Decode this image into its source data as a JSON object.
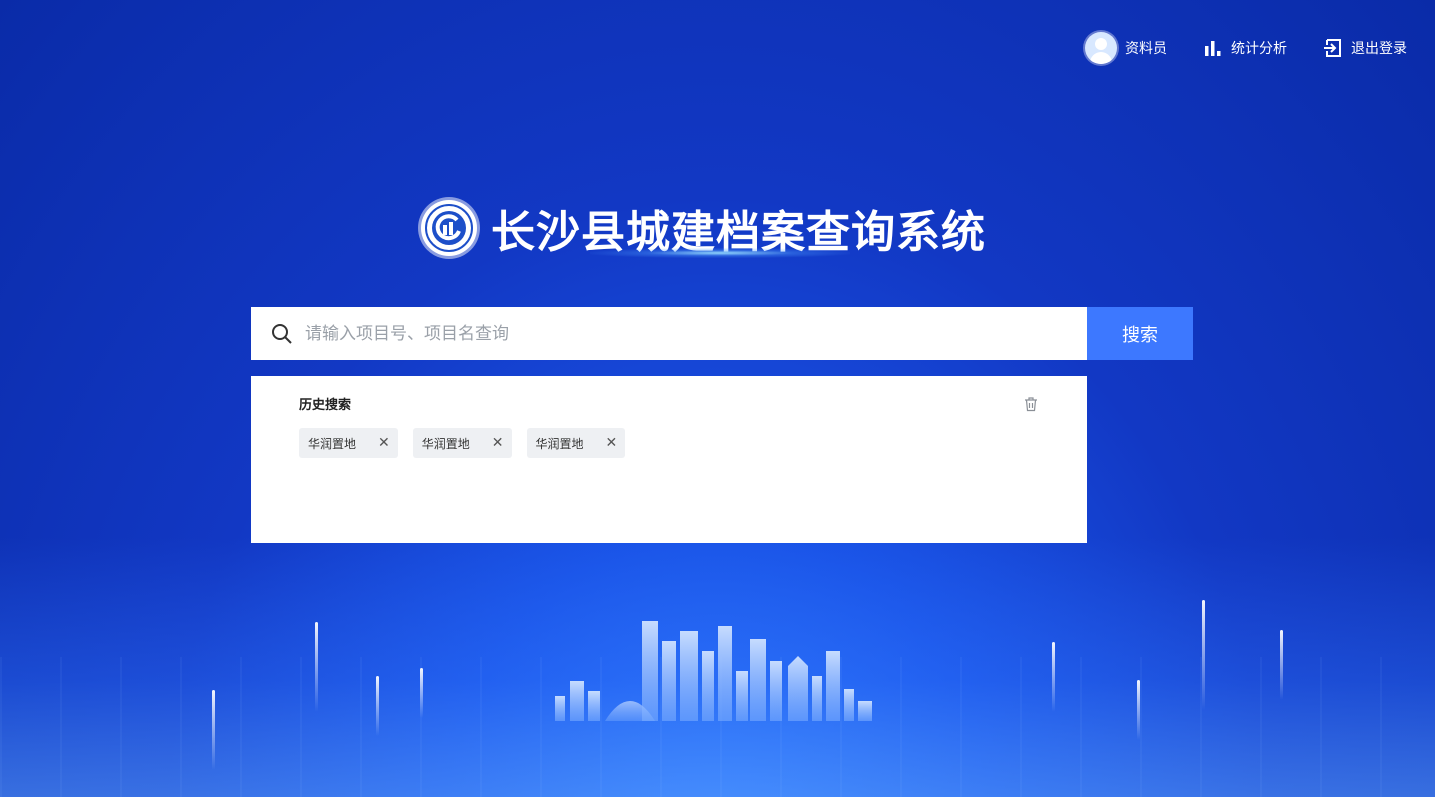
{
  "nav": {
    "user_label": "资料员",
    "stats_label": "统计分析",
    "logout_label": "退出登录"
  },
  "title": "长沙县城建档案查询系统",
  "search": {
    "placeholder": "请输入项目号、项目名查询",
    "value": "",
    "button_label": "搜索"
  },
  "history": {
    "title": "历史搜索",
    "tags": [
      {
        "label": "华润置地"
      },
      {
        "label": "华润置地"
      },
      {
        "label": "华润置地"
      }
    ]
  },
  "colors": {
    "accent": "#3d78ff",
    "background": "#1238c4"
  },
  "icons": {
    "avatar": "user-avatar",
    "stats": "bar-chart-icon",
    "logout": "logout-icon",
    "search": "search-icon",
    "trash": "trash-icon",
    "close": "close-icon"
  }
}
